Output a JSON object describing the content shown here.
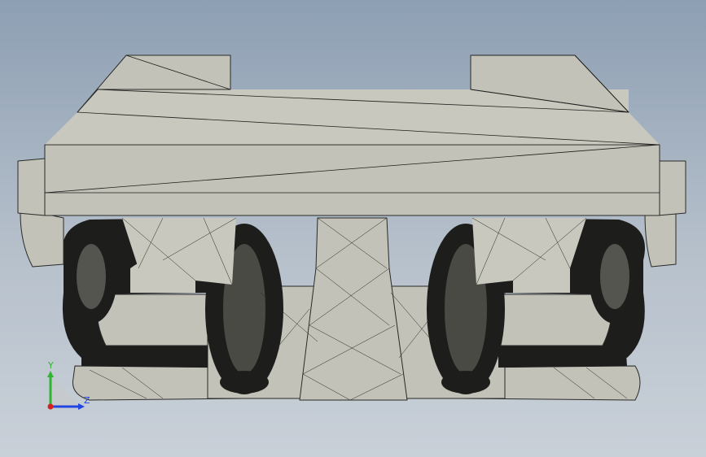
{
  "viewport": {
    "background_top": "#8d9fb3",
    "background_bottom": "#c9d0d8",
    "model_fill": "#c2c2b8",
    "mesh_line_color": "#1e1e1c",
    "render_mode": "shaded-with-mesh-edges"
  },
  "triad": {
    "y_label": "Y",
    "z_label": "Z",
    "y_color": "#2fb52f",
    "z_color": "#2345e0",
    "x_color": "#d42020"
  }
}
